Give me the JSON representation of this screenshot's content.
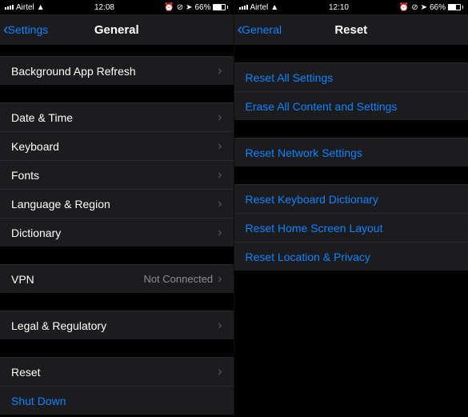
{
  "left": {
    "status": {
      "carrier": "Airtel",
      "time": "12:08",
      "battery_text": "66%"
    },
    "nav": {
      "back": "Settings",
      "title": "General"
    },
    "rows": {
      "bg_refresh": "Background App Refresh",
      "date_time": "Date & Time",
      "keyboard": "Keyboard",
      "fonts": "Fonts",
      "language_region": "Language & Region",
      "dictionary": "Dictionary",
      "vpn": "VPN",
      "vpn_value": "Not Connected",
      "legal": "Legal & Regulatory",
      "reset": "Reset",
      "shutdown": "Shut Down"
    }
  },
  "right": {
    "status": {
      "carrier": "Airtel",
      "time": "12:10",
      "battery_text": "66%"
    },
    "nav": {
      "back": "General",
      "title": "Reset"
    },
    "rows": {
      "reset_all": "Reset All Settings",
      "erase_all": "Erase All Content and Settings",
      "reset_network": "Reset Network Settings",
      "reset_keyboard": "Reset Keyboard Dictionary",
      "reset_home": "Reset Home Screen Layout",
      "reset_location": "Reset Location & Privacy"
    }
  }
}
